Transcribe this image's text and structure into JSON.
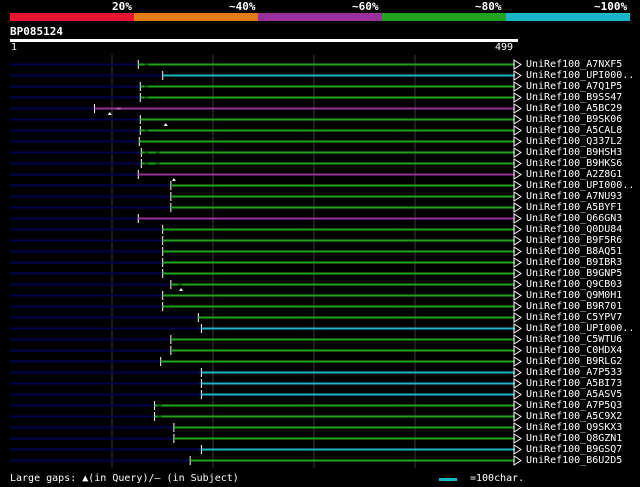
{
  "legend": {
    "labels": [
      "20%",
      "~40%",
      "~60%",
      "~80%",
      "~100%"
    ],
    "colors": [
      "#e8142f",
      "#e27a1a",
      "#9a2fa0",
      "#21a31d",
      "#1ab5c8"
    ]
  },
  "query": {
    "name": "BP085124",
    "start": "1",
    "end": "499",
    "length": 499
  },
  "colors": {
    "background": "#000000",
    "baseline": "#000050",
    "grid": "#3a3a3a",
    "green": "#21a31d",
    "cyan": "#1ab5c8",
    "purple": "#9a2fa0"
  },
  "hits": [
    {
      "label": "UniRef100_A7NXF5",
      "start": 126,
      "color": "green",
      "gaps": [
        132
      ]
    },
    {
      "label": "UniRef100_UPI000..",
      "start": 150,
      "color": "cyan",
      "gaps": []
    },
    {
      "label": "UniRef100_A7Q1P5",
      "start": 128,
      "color": "green",
      "gaps": [
        132
      ]
    },
    {
      "label": "UniRef100_B9SS47",
      "start": 128,
      "color": "green",
      "gaps": [
        132
      ]
    },
    {
      "label": "UniRef100_A5BC29",
      "start": 83,
      "color": "purple",
      "gaps": [
        105
      ],
      "markers": [
        98
      ]
    },
    {
      "label": "UniRef100_B9SK06",
      "start": 128,
      "color": "green",
      "gaps": [],
      "markers": [
        153
      ]
    },
    {
      "label": "UniRef100_A5CAL8",
      "start": 128,
      "color": "green",
      "gaps": [
        132
      ]
    },
    {
      "label": "UniRef100_Q337L2",
      "start": 127,
      "color": "green",
      "gaps": []
    },
    {
      "label": "UniRef100_B9HSH3",
      "start": 129,
      "color": "green",
      "gaps": [
        132,
        143
      ]
    },
    {
      "label": "UniRef100_B9HKS6",
      "start": 129,
      "color": "green",
      "gaps": [
        132,
        143
      ]
    },
    {
      "label": "UniRef100_A2Z8G1",
      "start": 126,
      "color": "purple",
      "gaps": [],
      "markers": [
        161
      ]
    },
    {
      "label": "UniRef100_UPI000..",
      "start": 158,
      "color": "green",
      "gaps": []
    },
    {
      "label": "UniRef100_A7NU93",
      "start": 158,
      "color": "green",
      "gaps": []
    },
    {
      "label": "UniRef100_A5BYF1",
      "start": 158,
      "color": "green",
      "gaps": []
    },
    {
      "label": "UniRef100_Q66GN3",
      "start": 126,
      "color": "purple",
      "gaps": []
    },
    {
      "label": "UniRef100_Q0DU84",
      "start": 150,
      "color": "green",
      "gaps": []
    },
    {
      "label": "UniRef100_B9F5R6",
      "start": 150,
      "color": "green",
      "gaps": []
    },
    {
      "label": "UniRef100_B8AQ51",
      "start": 150,
      "color": "green",
      "gaps": []
    },
    {
      "label": "UniRef100_B9IBR3",
      "start": 150,
      "color": "green",
      "gaps": []
    },
    {
      "label": "UniRef100_B9GNP5",
      "start": 150,
      "color": "green",
      "gaps": []
    },
    {
      "label": "UniRef100_Q9CB03",
      "start": 158,
      "color": "green",
      "gaps": [
        165
      ],
      "markers": [
        168
      ]
    },
    {
      "label": "UniRef100_Q9M0H1",
      "start": 150,
      "color": "green",
      "gaps": []
    },
    {
      "label": "UniRef100_B9R701",
      "start": 150,
      "color": "green",
      "gaps": []
    },
    {
      "label": "UniRef100_C5YPV7",
      "start": 185,
      "color": "green",
      "gaps": []
    },
    {
      "label": "UniRef100_UPI000..",
      "start": 188,
      "color": "cyan",
      "gaps": []
    },
    {
      "label": "UniRef100_C5WTU6",
      "start": 158,
      "color": "green",
      "gaps": []
    },
    {
      "label": "UniRef100_C0HDX4",
      "start": 158,
      "color": "green",
      "gaps": []
    },
    {
      "label": "UniRef100_B9RLG2",
      "start": 148,
      "color": "green",
      "gaps": []
    },
    {
      "label": "UniRef100_A7P533",
      "start": 188,
      "color": "cyan",
      "gaps": []
    },
    {
      "label": "UniRef100_A5BI73",
      "start": 188,
      "color": "cyan",
      "gaps": []
    },
    {
      "label": "UniRef100_A5ASV5",
      "start": 188,
      "color": "cyan",
      "gaps": []
    },
    {
      "label": "UniRef100_A7P5Q3",
      "start": 142,
      "color": "green",
      "gaps": [
        145
      ]
    },
    {
      "label": "UniRef100_A5C9X2",
      "start": 142,
      "color": "green",
      "gaps": [
        145
      ]
    },
    {
      "label": "UniRef100_Q9SKX3",
      "start": 161,
      "color": "green",
      "gaps": []
    },
    {
      "label": "UniRef100_Q8GZN1",
      "start": 161,
      "color": "green",
      "gaps": []
    },
    {
      "label": "UniRef100_B9GSQ7",
      "start": 188,
      "color": "cyan",
      "gaps": []
    },
    {
      "label": "UniRef100_B6U2D5",
      "start": 177,
      "color": "green",
      "gaps": []
    }
  ],
  "footer": {
    "gaps_text": "Large gaps: ▲(in Query)/– (in Subject)",
    "scale_text": "=100char."
  }
}
